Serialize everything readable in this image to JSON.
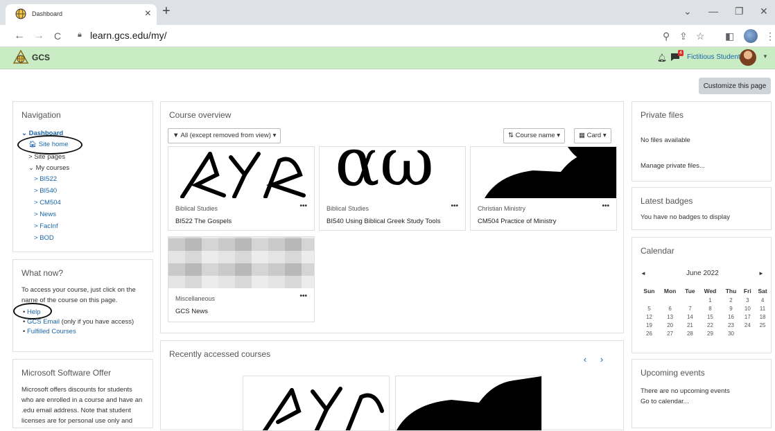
{
  "browser": {
    "tab_title": "Dashboard",
    "url": "learn.gcs.edu/my/",
    "new_tab": "+",
    "tab_close": "×",
    "back": "←",
    "forward": "→",
    "reload": "C",
    "window_minimize": "—",
    "window_restore": "❐",
    "window_close": "✕",
    "window_tab_menu": "⌄",
    "icons": [
      "zoom-icon",
      "share-icon",
      "star-icon",
      "sidebar-icon",
      "profile-icon",
      "kebab-menu-icon"
    ]
  },
  "header": {
    "brand": "GCS",
    "message_badge": "4",
    "username": "Fictitious Student",
    "accent_color": "#c9ecc4"
  },
  "customize_label": "Customize this page",
  "navigation": {
    "title": "Navigation",
    "dashboard": "Dashboard",
    "site_home": "Site home",
    "site_pages": "Site pages",
    "my_courses": "My courses",
    "courses": [
      "BI522",
      "BI540",
      "CM504",
      "News",
      "FacInf",
      "BOD"
    ]
  },
  "what_now": {
    "title": "What now?",
    "text_line1": "To access your course, just click on the",
    "text_line2": "name of the course on this page.",
    "help": "Help",
    "gcs_email": "GCS Email",
    "gcs_email_note": "(only if you have access)",
    "fulfilled": "Fulfilled Courses"
  },
  "microsoft": {
    "title": "Microsoft Software Offer",
    "lines": [
      "Microsoft offers discounts for students",
      "who are enrolled in a course and have an",
      ".edu email address. Note that student",
      "licenses are for personal use only and"
    ]
  },
  "course_overview": {
    "title": "Course overview",
    "filter": "All (except removed from view)",
    "sort": "Course name",
    "view": "Card",
    "courses": [
      {
        "category": "Biblical Studies",
        "name": "BI522 The Gospels"
      },
      {
        "category": "Biblical Studies",
        "name": "BI540 Using Biblical Greek Study Tools"
      },
      {
        "category": "Christian Ministry",
        "name": "CM504 Practice of Ministry"
      },
      {
        "category": "Miscellaneous",
        "name": "GCS News"
      }
    ],
    "greek_image_text": "αω"
  },
  "recent": {
    "title": "Recently accessed courses"
  },
  "private_files": {
    "title": "Private files",
    "empty": "No files available",
    "manage": "Manage private files..."
  },
  "badges": {
    "title": "Latest badges",
    "empty": "You have no badges to display"
  },
  "calendar": {
    "title": "Calendar",
    "month": "June 2022",
    "prev": "◄",
    "next": "►",
    "days": [
      "Sun",
      "Mon",
      "Tue",
      "Wed",
      "Thu",
      "Fri",
      "Sat"
    ],
    "weeks": [
      [
        "",
        "",
        "",
        "1",
        "2",
        "3",
        "4"
      ],
      [
        "5",
        "6",
        "7",
        "8",
        "9",
        "10",
        "11"
      ],
      [
        "12",
        "13",
        "14",
        "15",
        "16",
        "17",
        "18"
      ],
      [
        "19",
        "20",
        "21",
        "22",
        "23",
        "24",
        "25"
      ],
      [
        "26",
        "27",
        "28",
        "29",
        "30",
        "",
        ""
      ]
    ]
  },
  "upcoming": {
    "title": "Upcoming events",
    "empty": "There are no upcoming events",
    "goto": "Go to calendar..."
  }
}
